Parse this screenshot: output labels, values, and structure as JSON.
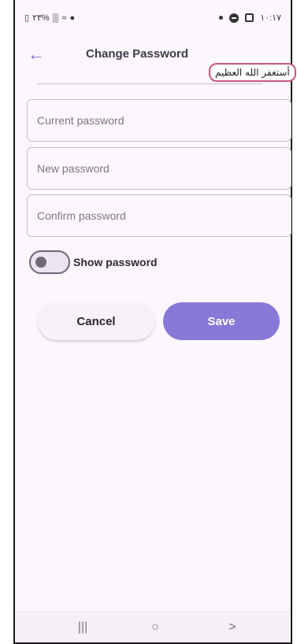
{
  "status_bar": {
    "left_text": "٢٣%",
    "battery_icon": "battery-icon",
    "signal_icon": "signal-icon",
    "wifi_icon": "wifi-icon",
    "alarm_icon": "alarm-icon",
    "time": "١٠:١٧"
  },
  "app_bar": {
    "title": "Change Password",
    "back_icon": "arrow-left-icon"
  },
  "overlay": {
    "text": "أستغفر الله العظيم"
  },
  "fields": {
    "current_password_placeholder": "Current password",
    "new_password_placeholder": "New password",
    "confirm_password_placeholder": "Confirm password"
  },
  "toggle": {
    "label": "Show password",
    "checked": false
  },
  "buttons": {
    "cancel": "Cancel",
    "save": "Save"
  },
  "nav_bar": {
    "recents": "|||",
    "home": "○",
    "back": ">"
  },
  "colors": {
    "accent": "#8878d8",
    "back_arrow": "#7e72cc",
    "background": "#fcf6fd",
    "overlay_border": "#c7577c"
  }
}
